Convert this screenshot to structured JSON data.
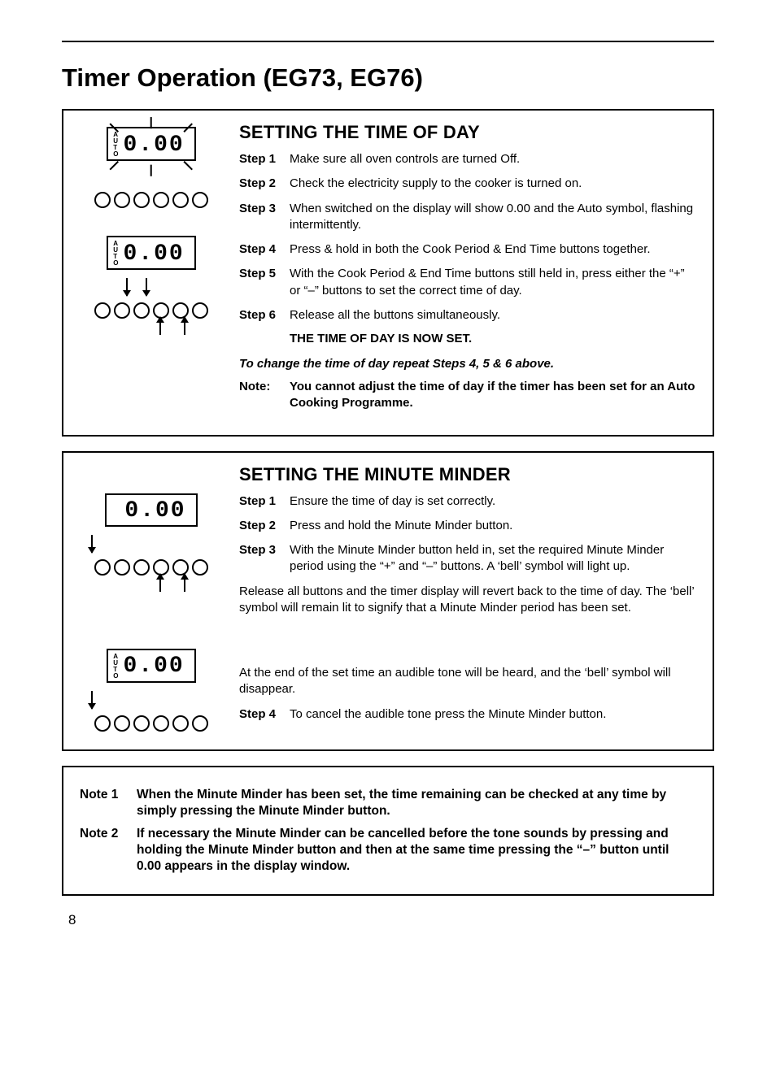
{
  "title": "Timer Operation (EG73, EG76)",
  "autoLabel": "AUTO",
  "display": "0.00",
  "section1": {
    "heading": "SETTING THE TIME OF DAY",
    "steps": [
      {
        "label": "Step 1",
        "text": "Make sure all oven controls are turned Off."
      },
      {
        "label": "Step 2",
        "text": "Check the electricity supply to the cooker is turned on."
      },
      {
        "label": "Step 3",
        "text": "When switched on the display will show 0.00 and the Auto symbol, flashing intermittently."
      },
      {
        "label": "Step 4",
        "text": "Press & hold in both the Cook Period & End Time buttons together."
      },
      {
        "label": "Step 5",
        "text": "With the Cook Period & End Time buttons still held in, press either the “+” or “–” buttons to set the correct time of day."
      },
      {
        "label": "Step 6",
        "text": "Release all the buttons simultaneously."
      }
    ],
    "setLine": "THE TIME OF DAY IS NOW SET.",
    "changeLine": "To change the time of day repeat Steps 4, 5 & 6 above.",
    "noteLabel": "Note:",
    "noteText": "You cannot adjust the time of day if the timer has been set for an Auto Cooking Programme."
  },
  "section2": {
    "heading": "SETTING THE MINUTE MINDER",
    "steps123": [
      {
        "label": "Step 1",
        "text": "Ensure the time of day is set correctly."
      },
      {
        "label": "Step 2",
        "text": "Press and hold the Minute Minder button."
      },
      {
        "label": "Step 3",
        "text": "With the Minute Minder button held in, set the required Minute Minder period using the “+” and “–” buttons. A ‘bell’ symbol will light up."
      }
    ],
    "para1": "Release all buttons and the timer display will revert back to the time of day. The ‘bell’ symbol will remain lit to signify that a Minute Minder period has been set.",
    "para2": "At the end of the set time an audible tone will be heard, and the ‘bell’ symbol will disappear.",
    "step4": {
      "label": "Step 4",
      "text": "To cancel the audible tone press the Minute Minder button."
    }
  },
  "notes": [
    {
      "label": "Note 1",
      "text": "When the Minute Minder has been set, the time remaining can be checked at any time by simply pressing the Minute Minder button."
    },
    {
      "label": "Note 2",
      "text": "If necessary the Minute Minder can be cancelled before the tone sounds by pressing and holding the Minute Minder button and then at the same time pressing the “–” button until 0.00 appears in the display window."
    }
  ],
  "pageNumber": "8"
}
